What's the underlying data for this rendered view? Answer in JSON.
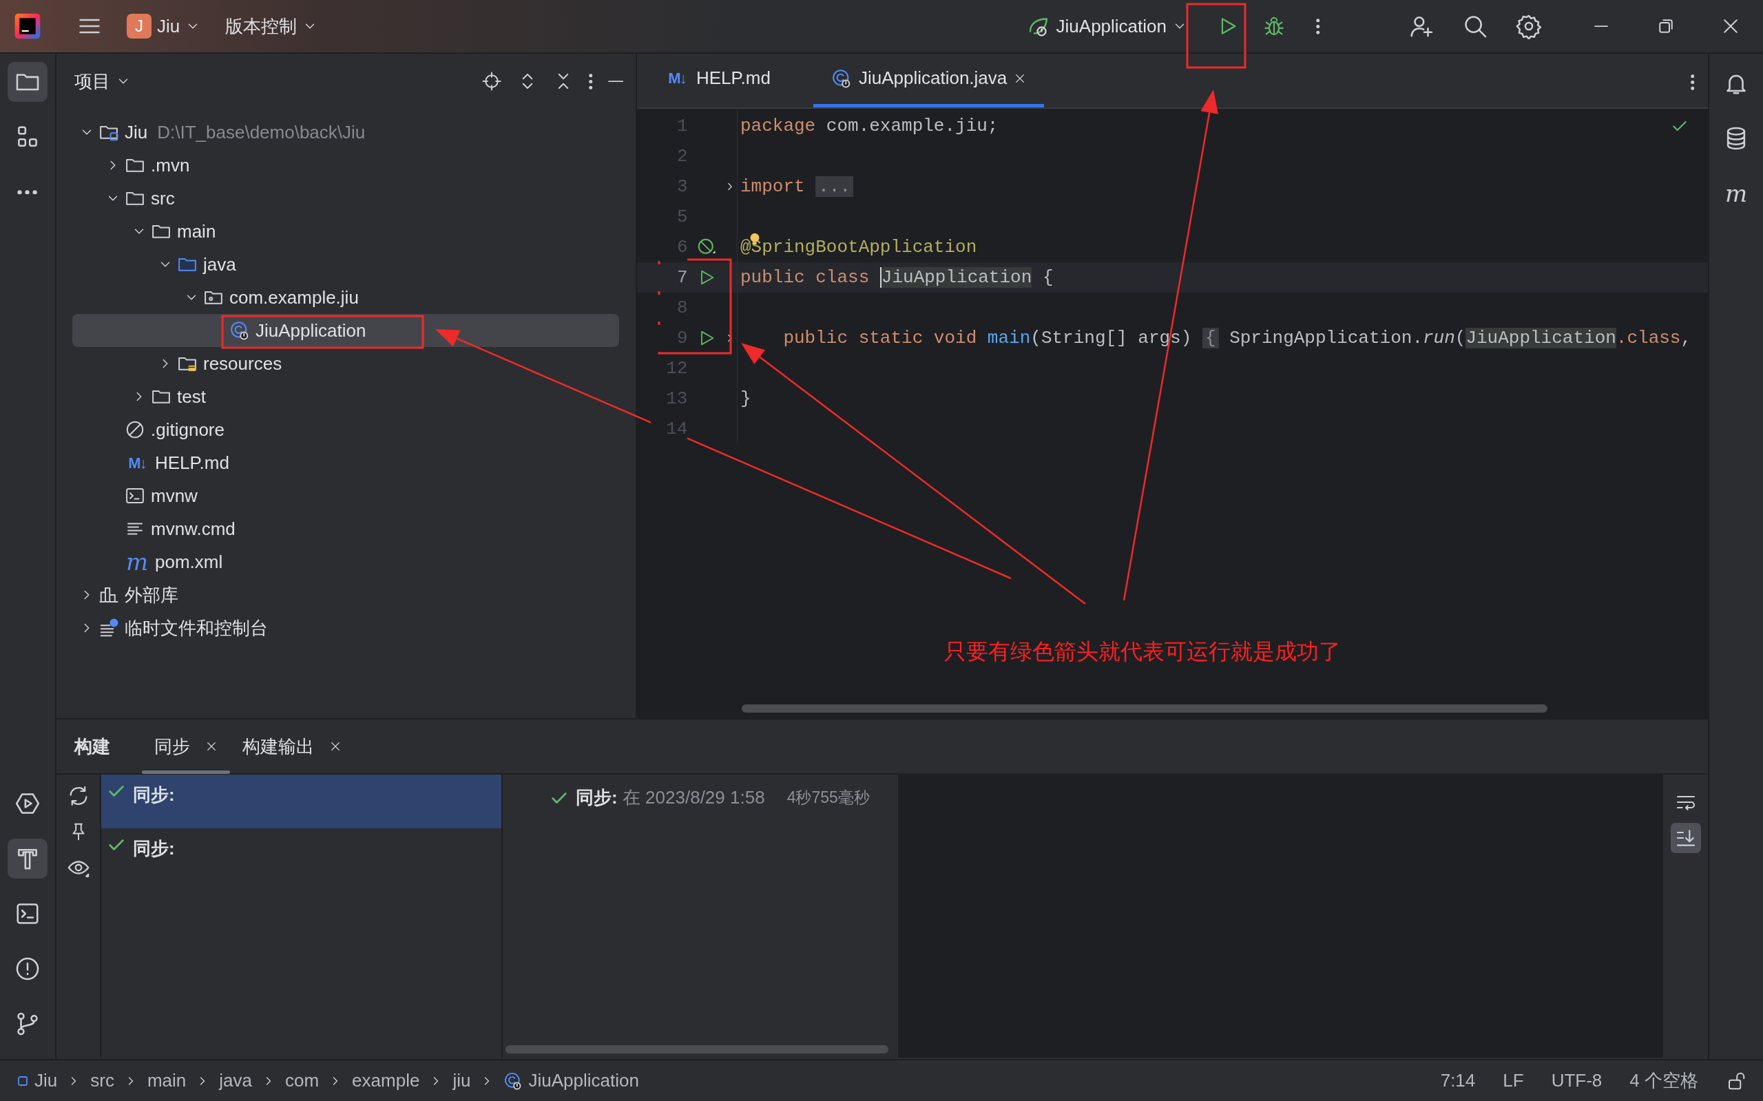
{
  "title_bar": {
    "project_badge": "J",
    "project": "Jiu",
    "vcs": "版本控制",
    "run_config": "JiuApplication"
  },
  "left_strip": {
    "top": [
      {
        "kind": "project",
        "selected": true
      },
      {
        "kind": "structure",
        "selected": false
      },
      {
        "kind": "more",
        "selected": false
      }
    ],
    "bottom": [
      {
        "kind": "services",
        "selected": false
      },
      {
        "kind": "build",
        "selected": true
      },
      {
        "kind": "terminal",
        "selected": false
      },
      {
        "kind": "problems",
        "selected": false
      },
      {
        "kind": "git",
        "selected": false
      }
    ]
  },
  "right_strip": [
    {
      "kind": "notifications"
    },
    {
      "kind": "database"
    },
    {
      "kind": "maven",
      "icon_text": "m"
    }
  ],
  "project_panel": {
    "title": "项目"
  },
  "tree": [
    {
      "label": "Jiu",
      "path": "D:\\IT_base\\demo\\back\\Jiu",
      "kind": "module",
      "expanded": true,
      "selected": false,
      "children": [
        {
          "label": ".mvn",
          "kind": "folder",
          "expanded": false,
          "selected": false
        },
        {
          "label": "src",
          "kind": "folder",
          "expanded": true,
          "selected": false,
          "children": [
            {
              "label": "main",
              "kind": "folder",
              "expanded": true,
              "selected": false,
              "children": [
                {
                  "label": "java",
                  "kind": "source",
                  "expanded": true,
                  "selected": false,
                  "children": [
                    {
                      "label": "com.example.jiu",
                      "kind": "package",
                      "expanded": true,
                      "selected": false,
                      "children": [
                        {
                          "label": "JiuApplication",
                          "kind": "spring-class",
                          "selected": true
                        }
                      ]
                    }
                  ]
                },
                {
                  "label": "resources",
                  "kind": "resources",
                  "expanded": false,
                  "selected": false
                }
              ]
            },
            {
              "label": "test",
              "kind": "folder",
              "expanded": false,
              "selected": false
            }
          ]
        },
        {
          "label": ".gitignore",
          "kind": "ignore",
          "selected": false
        },
        {
          "label": "HELP.md",
          "kind": "markdown",
          "icon_text": "M↓",
          "selected": false
        },
        {
          "label": "mvnw",
          "kind": "shell",
          "selected": false
        },
        {
          "label": "mvnw.cmd",
          "kind": "text",
          "selected": false
        },
        {
          "label": "pom.xml",
          "kind": "maven",
          "icon_text": "m",
          "selected": false
        }
      ]
    },
    {
      "label": "外部库",
      "kind": "library",
      "expanded": false,
      "selected": false
    },
    {
      "label": "临时文件和控制台",
      "kind": "scratch",
      "expanded": false,
      "selected": false
    }
  ],
  "editor_tabs": [
    {
      "label": "HELP.md",
      "kind": "markdown",
      "icon_text": "M↓",
      "selected": false,
      "closable": false
    },
    {
      "label": "JiuApplication.java",
      "kind": "spring-class",
      "selected": true,
      "closable": true
    }
  ],
  "lines": [
    {
      "number": "1",
      "kind": "plain",
      "current": false,
      "tokens": [
        {
          "kind": "keyword",
          "text": "package"
        },
        {
          "kind": "plain",
          "text": " com.example.jiu;"
        }
      ]
    },
    {
      "number": "2",
      "kind": "plain",
      "current": false
    },
    {
      "number": "3",
      "kind": "plain",
      "current": false,
      "fold": true,
      "tokens": [
        {
          "kind": "keyword",
          "text": "import "
        },
        {
          "kind": "folded",
          "text": "..."
        }
      ]
    },
    {
      "number": "5",
      "kind": "plain",
      "current": false
    },
    {
      "number": "6",
      "kind": "bean",
      "current": false,
      "intention": true,
      "tokens": [
        {
          "kind": "annotation",
          "text": "@SpringBootApplication"
        }
      ]
    },
    {
      "number": "7",
      "kind": "run",
      "current": true,
      "tokens": [
        {
          "kind": "keyword",
          "text": "public class "
        },
        {
          "kind": "highlight",
          "text": "JiuApplication",
          "caret": true
        },
        {
          "kind": "plain",
          "text": " {"
        }
      ]
    },
    {
      "number": "8",
      "kind": "plain",
      "current": false
    },
    {
      "number": "9",
      "kind": "run",
      "current": false,
      "fold": true,
      "tokens": [
        {
          "kind": "keyword",
          "text": "    public static void "
        },
        {
          "kind": "method",
          "text": "main"
        },
        {
          "kind": "plain",
          "text": "(String[] args) "
        },
        {
          "kind": "folded",
          "text": "{"
        },
        {
          "kind": "plain",
          "text": " SpringApplication."
        },
        {
          "kind": "italic",
          "text": "run"
        },
        {
          "kind": "plain",
          "text": "("
        },
        {
          "kind": "highlight",
          "text": "JiuApplication"
        },
        {
          "kind": "keyword",
          "text": ".class"
        },
        {
          "kind": "plain",
          "text": ","
        }
      ]
    },
    {
      "number": "12",
      "kind": "plain",
      "current": false
    },
    {
      "number": "13",
      "kind": "plain",
      "current": false,
      "tokens": [
        {
          "kind": "plain",
          "text": "}"
        }
      ]
    },
    {
      "number": "14",
      "kind": "plain",
      "current": false
    }
  ],
  "build_panel": {
    "title": "构建",
    "tabs": [
      {
        "label": "同步",
        "selected": true,
        "closable": true
      },
      {
        "label": "构建输出",
        "selected": false,
        "closable": true
      }
    ],
    "items": [
      {
        "label": "同步:",
        "selected": true
      },
      {
        "label": "同步:",
        "selected": false
      }
    ],
    "detail": {
      "title": "同步:",
      "time": "在 2023/8/29 1:58",
      "duration": "4秒755毫秒"
    },
    "tools": [
      {
        "kind": "soft-wrap",
        "selected": false
      },
      {
        "kind": "scroll-to-end",
        "selected": true
      }
    ]
  },
  "breadcrumbs": [
    {
      "label": "Jiu",
      "kind": "module"
    },
    {
      "label": "src",
      "kind": "plain"
    },
    {
      "label": "main",
      "kind": "plain"
    },
    {
      "label": "java",
      "kind": "plain"
    },
    {
      "label": "com",
      "kind": "plain"
    },
    {
      "label": "example",
      "kind": "plain"
    },
    {
      "label": "jiu",
      "kind": "plain"
    },
    {
      "label": "JiuApplication",
      "kind": "spring-class"
    }
  ],
  "status": [
    "7:14",
    "LF",
    "UTF-8",
    "4 个空格"
  ],
  "annotation": {
    "note": "只要有绿色箭头就代表可运行就是成功了"
  }
}
